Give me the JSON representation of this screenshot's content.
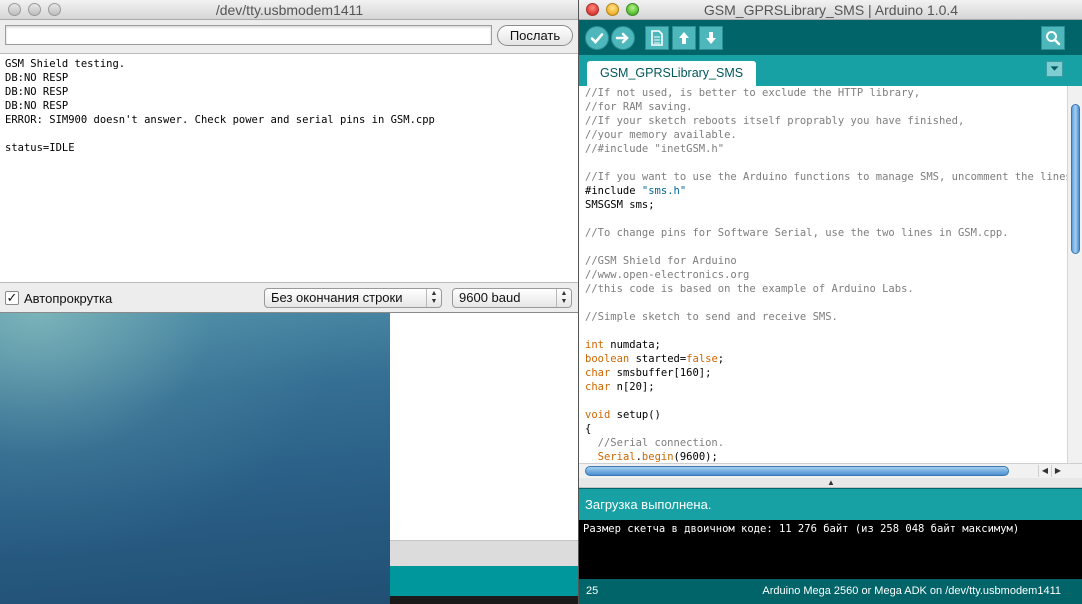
{
  "serial_monitor": {
    "title": "/dev/tty.usbmodem1411",
    "input_value": "",
    "send_label": "Послать",
    "output_lines": [
      "GSM Shield testing.",
      "DB:NO RESP",
      "DB:NO RESP",
      "DB:NO RESP",
      "ERROR: SIM900 doesn't answer. Check power and serial pins in GSM.cpp",
      "",
      "status=IDLE"
    ],
    "autoscroll_label": "Автопрокрутка",
    "autoscroll_checked": true,
    "line_ending": "Без окончания строки",
    "baud_rate": "9600 baud"
  },
  "ide": {
    "title": "GSM_GPRSLibrary_SMS | Arduino 1.0.4",
    "toolbar_icons": [
      "verify-icon",
      "upload-icon",
      "new-icon",
      "open-icon",
      "save-icon",
      "serial-monitor-icon"
    ],
    "tab_label": "GSM_GPRSLibrary_SMS",
    "status_message": "Загрузка выполнена.",
    "console_text": "Размер скетча в двоичном коде: 11 276 байт (из 258 048 байт максимум)",
    "footer_line": "25",
    "footer_board": "Arduino Mega 2560 or Mega ADK on /dev/tty.usbmodem1411"
  },
  "code": {
    "l1": "//If not used, is better to exclude the HTTP library,",
    "l2": "//for RAM saving.",
    "l3": "//If your sketch reboots itself proprably you have finished,",
    "l4": "//your memory available.",
    "l5": "//#include \"inetGSM.h\"",
    "l7": "//If you want to use the Arduino functions to manage SMS, uncomment the lines below.",
    "l8_kw": "#include ",
    "l8_str": "\"sms.h\"",
    "l9": "SMSGSM sms;",
    "l11": "//To change pins for Software Serial, use the two lines in GSM.cpp.",
    "l13": "//GSM Shield for Arduino",
    "l14": "//www.open-electronics.org",
    "l15": "//this code is based on the example of Arduino Labs.",
    "l17": "//Simple sketch to send and receive SMS.",
    "l19_type": "int",
    "l19_rest": " numdata;",
    "l20_type": "boolean",
    "l20_mid": " started=",
    "l20_val": "false",
    "l20_end": ";",
    "l21_type": "char",
    "l21_rest": " smsbuffer[160];",
    "l22_type": "char",
    "l22_rest": " n[20];",
    "l24_type": "void",
    "l24_rest": " setup()",
    "l25": "{",
    "l26": "  //Serial connection.",
    "l27_pre": "  ",
    "l27_obj": "Serial",
    "l27_dot": ".",
    "l27_fn": "begin",
    "l27_end": "(9600);"
  },
  "colors": {
    "teal_dark": "#006468",
    "teal_mid": "#17a1a5",
    "comment": "#7e7e7e",
    "keyword": "#cc6600",
    "string": "#006699"
  }
}
